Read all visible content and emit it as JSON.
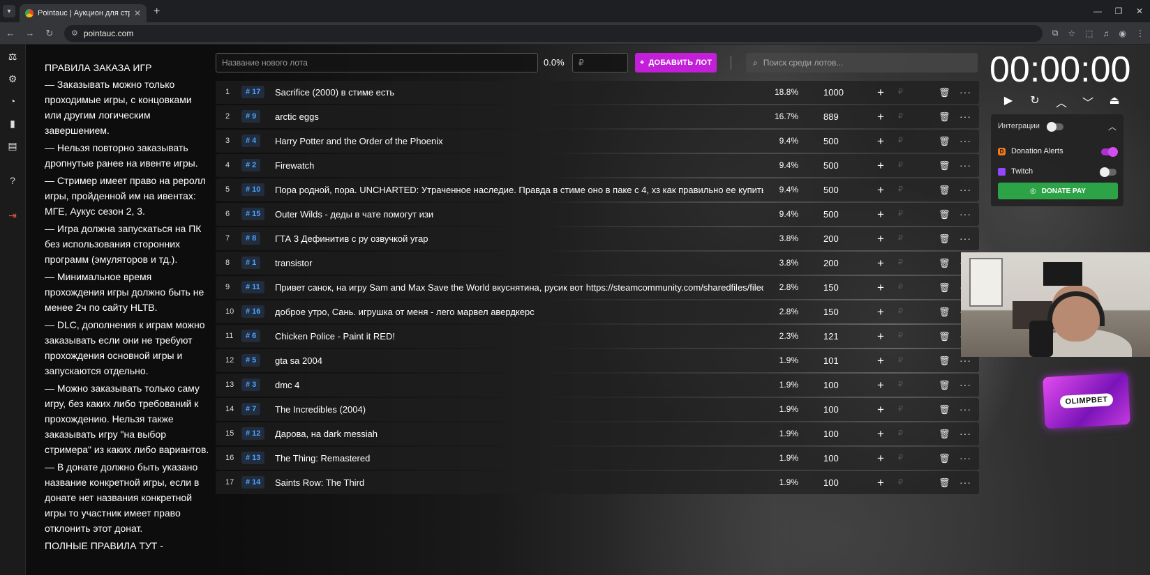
{
  "browser": {
    "tab_title": "Pointauc | Аукцион для стримеров",
    "url": "pointauc.com"
  },
  "lot_form": {
    "name_placeholder": "Название нового лота",
    "percent": "0.0%",
    "amount_placeholder": "₽",
    "add_label": "ДОБАВИТЬ ЛОТ",
    "search_placeholder": "Поиск среди лотов..."
  },
  "rules": {
    "title": "ПРАВИЛА ЗАКАЗА ИГР",
    "items": [
      "— Заказывать можно только проходимые игры, с концовками или другим логическим завершением.",
      "— Нельзя повторно заказывать дропнутые ранее на ивенте игры.",
      "— Стример имеет право на реролл игры, пройденной им на ивентах: МГЕ, Аукус сезон 2, 3.",
      "— Игра должна запускаться на ПК без использования сторонних программ (эмуляторов и тд.).",
      "— Минимальное время прохождения игры должно быть не менее 2ч по сайту HLTB.",
      "— DLC, дополнения к играм можно заказывать если они не требуют прохождения основной игры и запускаются отдельно.",
      "— Можно заказывать только саму игру, без каких либо требований к прохождению. Нельзя также заказывать игру \"на выбор стримера\" из каких либо вариантов.",
      "— В донате должно быть указано название конкретной игры, если в донате нет названия конкретной игры то участник имеет право отклонить этот донат."
    ],
    "footer": "ПОЛНЫЕ ПРАВИЛА ТУТ -"
  },
  "lots": [
    {
      "n": "1",
      "id": "# 17",
      "name": "Sacrifice (2000) в стиме есть",
      "pct": "18.8%",
      "amount": "1000"
    },
    {
      "n": "2",
      "id": "# 9",
      "name": "arctic eggs",
      "pct": "16.7%",
      "amount": "889"
    },
    {
      "n": "3",
      "id": "# 4",
      "name": "Harry Potter and the Order of the Phoenix",
      "pct": "9.4%",
      "amount": "500"
    },
    {
      "n": "4",
      "id": "# 2",
      "name": "Firewatch",
      "pct": "9.4%",
      "amount": "500"
    },
    {
      "n": "5",
      "id": "# 10",
      "name": "Пора родной, пора. UNCHARTED: Утраченное наследие. Правда в стиме оно в паке с 4, хз как правильно ее купить",
      "pct": "9.4%",
      "amount": "500"
    },
    {
      "n": "6",
      "id": "# 15",
      "name": "Outer Wilds - деды в чате помогут изи",
      "pct": "9.4%",
      "amount": "500"
    },
    {
      "n": "7",
      "id": "# 8",
      "name": "ГТА 3 Дефинитив с ру озвучкой угар",
      "pct": "3.8%",
      "amount": "200"
    },
    {
      "n": "8",
      "id": "# 1",
      "name": "transistor",
      "pct": "3.8%",
      "amount": "200"
    },
    {
      "n": "9",
      "id": "# 11",
      "name": "Привет санок, на игру Sam and Max Save the World вкуснятина, русик вот https://steamcommunity.com/sharedfiles/filedetails",
      "pct": "2.8%",
      "amount": "150"
    },
    {
      "n": "10",
      "id": "# 16",
      "name": "доброе утро, Сань. игрушка от меня - лего марвел авердкерс",
      "pct": "2.8%",
      "amount": "150"
    },
    {
      "n": "11",
      "id": "# 6",
      "name": "Chicken Police - Paint it RED!",
      "pct": "2.3%",
      "amount": "121"
    },
    {
      "n": "12",
      "id": "# 5",
      "name": "gta sa 2004",
      "pct": "1.9%",
      "amount": "101"
    },
    {
      "n": "13",
      "id": "# 3",
      "name": "dmc 4",
      "pct": "1.9%",
      "amount": "100"
    },
    {
      "n": "14",
      "id": "# 7",
      "name": "The Incredibles (2004)",
      "pct": "1.9%",
      "amount": "100"
    },
    {
      "n": "15",
      "id": "# 12",
      "name": "Дарова, на dark messiah",
      "pct": "1.9%",
      "amount": "100"
    },
    {
      "n": "16",
      "id": "# 13",
      "name": "The Thing: Remastered",
      "pct": "1.9%",
      "amount": "100"
    },
    {
      "n": "17",
      "id": "# 14",
      "name": "Saints Row: The Third",
      "pct": "1.9%",
      "amount": "100"
    }
  ],
  "timer": {
    "value": "00:00:00"
  },
  "integrations": {
    "title": "Интеграции",
    "donation_alerts": "Donation Alerts",
    "twitch": "Twitch",
    "donatepay": "DONATE PAY",
    "donation_alerts_on": true,
    "twitch_on": false,
    "master_on": false
  },
  "sponsor": {
    "label": "OLIMPBET"
  },
  "colors": {
    "accent": "#c41fd8",
    "lot_id": "#4da3ff",
    "donatepay": "#2da347"
  }
}
